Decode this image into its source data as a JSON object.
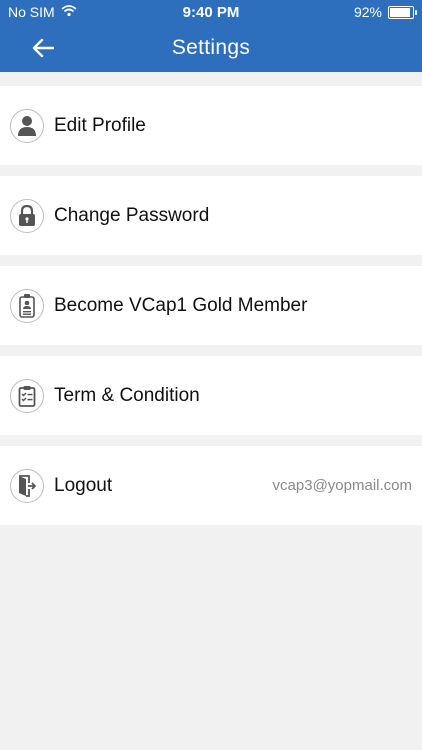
{
  "status_bar": {
    "carrier": "No SIM",
    "time": "9:40 PM",
    "battery": "92%",
    "battery_level": 0.92
  },
  "header": {
    "title": "Settings"
  },
  "menu": [
    {
      "label": "Edit Profile",
      "icon": "user-icon"
    },
    {
      "label": "Change Password",
      "icon": "lock-icon"
    },
    {
      "label": "Become VCap1 Gold Member",
      "icon": "badge-icon"
    },
    {
      "label": "Term & Condition",
      "icon": "clipboard-icon"
    },
    {
      "label": "Logout",
      "icon": "logout-icon",
      "detail": "vcap3@yopmail.com"
    }
  ],
  "colors": {
    "accent": "#2e6fbd",
    "background": "#f1f1f1"
  }
}
